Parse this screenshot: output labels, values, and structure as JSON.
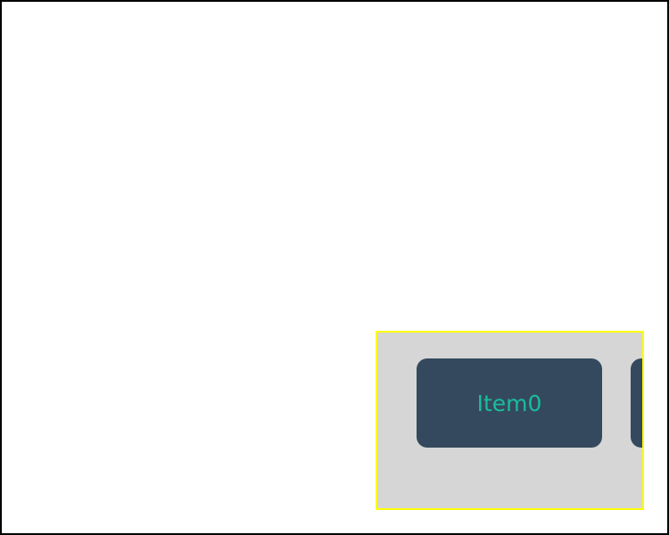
{
  "carousel": {
    "items": [
      {
        "label": "Item0"
      },
      {
        "label": ""
      }
    ]
  },
  "colors": {
    "window_border": "#000000",
    "window_background": "#ffffff",
    "panel_border": "#ffff00",
    "panel_background": "#d6d6d6",
    "card_background": "#34495e",
    "card_text": "#1abc9c"
  }
}
